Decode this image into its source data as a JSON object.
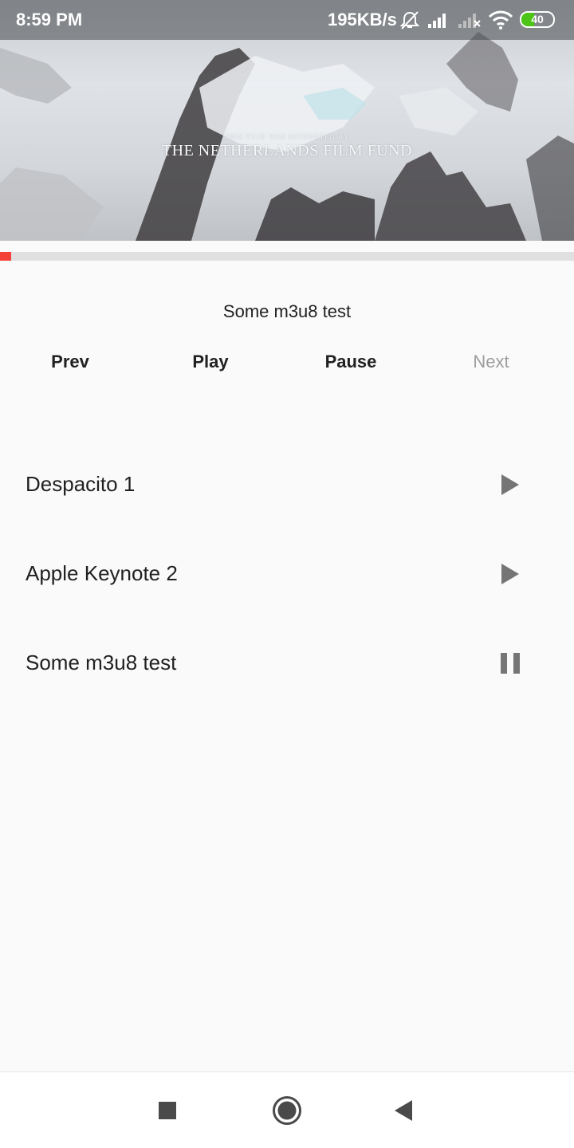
{
  "status_bar": {
    "time": "8:59 PM",
    "network_speed": "195KB/s",
    "battery_level": "40",
    "battery_fraction": 0.4,
    "icons": [
      "mute-bell-icon",
      "signal-icon",
      "signal-no-sim-icon",
      "wifi-icon",
      "battery-icon"
    ]
  },
  "video": {
    "credit_small": "THIS FILM WAS SUPPORTED BY",
    "credit_big": "THE NETHERLANDS FILM FUND"
  },
  "progress": {
    "fraction": 0.02,
    "color": "#f44336"
  },
  "now_playing": {
    "title": "Some m3u8 test"
  },
  "controls": {
    "prev": "Prev",
    "play": "Play",
    "pause": "Pause",
    "next": "Next"
  },
  "playlist": [
    {
      "title": "Despacito 1",
      "state_icon": "play-icon"
    },
    {
      "title": "Apple Keynote 2",
      "state_icon": "play-icon"
    },
    {
      "title": "Some m3u8 test",
      "state_icon": "pause-icon"
    }
  ],
  "nav_bar": {
    "icons": [
      "recents-square-icon",
      "home-circle-icon",
      "back-triangle-icon"
    ]
  }
}
